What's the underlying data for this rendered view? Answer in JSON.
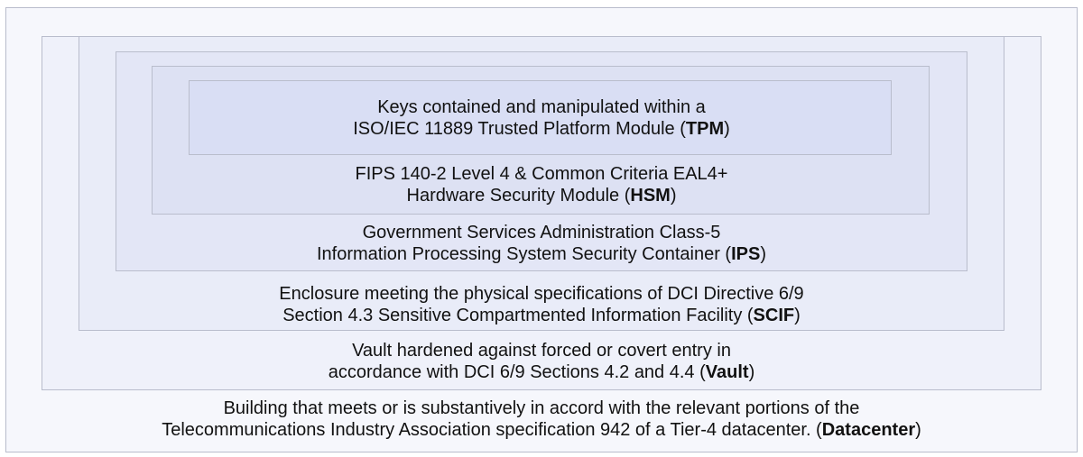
{
  "layers": [
    {
      "id": "tpm",
      "line1": "Keys contained and manipulated within a",
      "line2_prefix": "ISO/IEC 11889 Trusted Platform Module (",
      "abbr": "TPM",
      "line2_suffix": ")"
    },
    {
      "id": "hsm",
      "line1": "FIPS 140-2 Level 4 & Common Criteria EAL4+",
      "line2_prefix": "Hardware Security Module (",
      "abbr": "HSM",
      "line2_suffix": ")"
    },
    {
      "id": "ips",
      "line1": "Government Services Administration Class-5",
      "line2_prefix": "Information Processing System Security Container (",
      "abbr": "IPS",
      "line2_suffix": ")"
    },
    {
      "id": "scif",
      "line1": "Enclosure meeting the physical specifications of DCI Directive 6/9",
      "line2_prefix": "Section 4.3 Sensitive Compartmented Information Facility (",
      "abbr": "SCIF",
      "line2_suffix": ")"
    },
    {
      "id": "vault",
      "line1": "Vault hardened against forced or covert entry in",
      "line2_prefix": "accordance with DCI 6/9 Sections 4.2 and 4.4 (",
      "abbr": "Vault",
      "line2_suffix": ")"
    },
    {
      "id": "datacenter",
      "line1": "Building that meets or is substantively in accord with the relevant portions of the",
      "line2_prefix": "Telecommunications Industry Association specification 942 of a Tier-4 datacenter. (",
      "abbr": "Datacenter",
      "line2_suffix": ")"
    }
  ]
}
